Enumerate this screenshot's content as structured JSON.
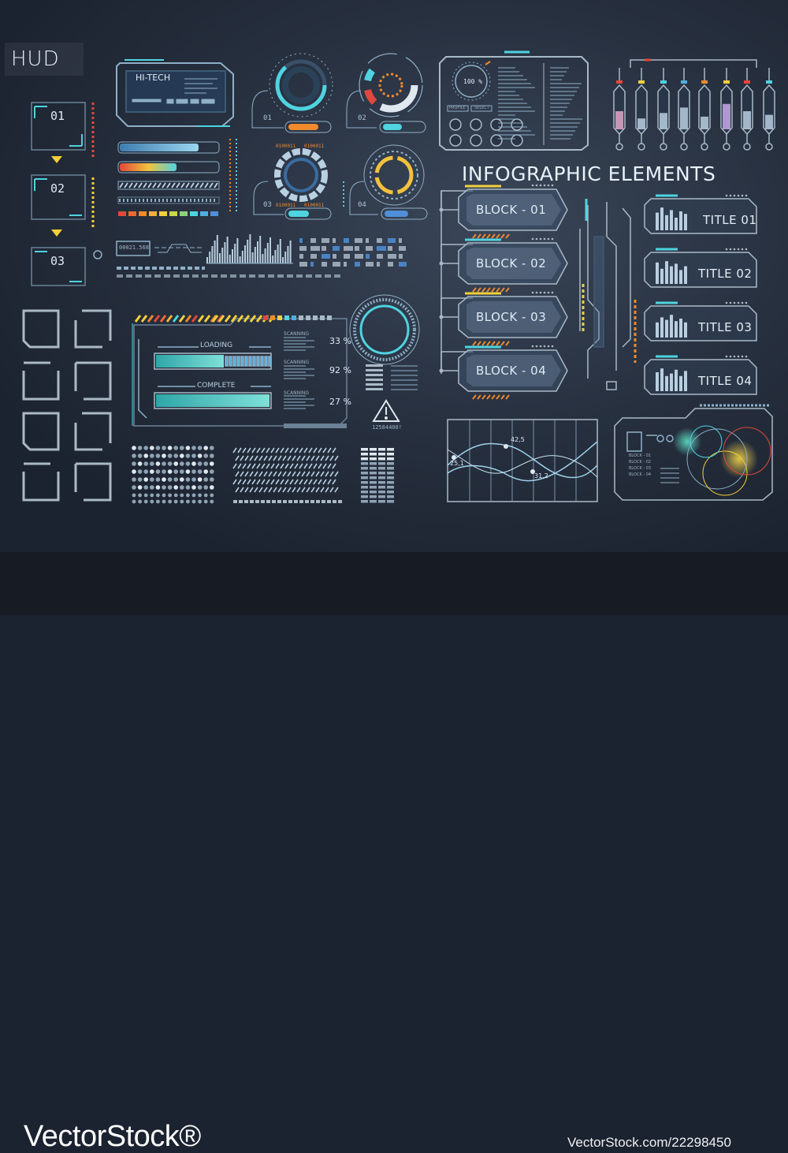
{
  "hud_title": "HUD",
  "hitech_label": "HI-TECH",
  "infographic_title": "INFOGRAPHIC ELEMENTS",
  "side_numbers": [
    "01",
    "02",
    "03"
  ],
  "ring_labels": [
    "01",
    "02",
    "03",
    "04"
  ],
  "binary_texts": [
    "0100011",
    "0100011",
    "0100011",
    "0100011"
  ],
  "device": {
    "percent": "100 %",
    "buttons": [
      "PROFILE",
      "SELECT"
    ]
  },
  "counter": "00021.568",
  "loading": {
    "loading_label": "LOADING",
    "complete_label": "COMPLETE"
  },
  "scanning": [
    {
      "label": "SCANNING",
      "value": "33 %"
    },
    {
      "label": "SCANNING",
      "value": "92 %"
    },
    {
      "label": "SCANNING",
      "value": "27 %"
    }
  ],
  "serial": "12584400!",
  "blocks": [
    "BLOCK - 01",
    "BLOCK - 02",
    "BLOCK - 03",
    "BLOCK - 04"
  ],
  "titles": [
    "TITLE 01",
    "TITLE 02",
    "TITLE 03",
    "TITLE 04"
  ],
  "wave_labels": [
    "25,1",
    "42,5",
    "31,2"
  ],
  "legend_items": [
    "BLOCK - 01",
    "BLOCK - 02",
    "BLOCK - 03",
    "BLOCK - 04"
  ],
  "watermark_left": "VectorStock®",
  "watermark_right": "VectorStock.com/22298450",
  "colors": {
    "accent_cyan": "#4fd3e0",
    "accent_orange": "#f08a2c",
    "accent_yellow": "#f2d03c",
    "accent_red": "#e2483c",
    "line": "#8fb0c8"
  }
}
